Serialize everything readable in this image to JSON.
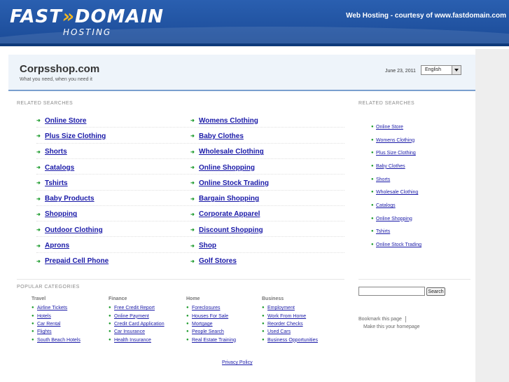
{
  "banner": {
    "logo_main_a": "FAST",
    "logo_main_b": "DOMAIN",
    "logo_sub": "HOSTING",
    "credit": "Web Hosting - courtesy of www.fastdomain.com"
  },
  "header": {
    "title": "Corpsshop.com",
    "tagline": "What you need, when you need it",
    "date": "June 23, 2011",
    "language": "English"
  },
  "related_label": "RELATED SEARCHES",
  "main_links": [
    "Online Store",
    "Womens Clothing",
    "Plus Size Clothing",
    "Baby Clothes",
    "Shorts",
    "Wholesale Clothing",
    "Catalogs",
    "Online Shopping",
    "Tshirts",
    "Online Stock Trading",
    "Baby Products",
    "Bargain Shopping",
    "Shopping",
    "Corporate Apparel",
    "Outdoor Clothing",
    "Discount Shopping",
    "Aprons",
    "Shop",
    "Prepaid Cell Phone",
    "Golf Stores"
  ],
  "side_label": "RELATED SEARCHES",
  "side_links": [
    "Online Store",
    "Womens Clothing",
    "Plus Size Clothing",
    "Baby Clothes",
    "Shorts",
    "Wholesale Clothing",
    "Catalogs",
    "Online Shopping",
    "Tshirts",
    "Online Stock Trading"
  ],
  "popular_label": "POPULAR CATEGORIES",
  "categories": [
    {
      "heading": "Travel",
      "items": [
        "Airline Tickets",
        "Hotels",
        "Car Rental",
        "Flights",
        "South Beach Hotels"
      ]
    },
    {
      "heading": "Finance",
      "items": [
        "Free Credit Report",
        "Online Payment",
        "Credit Card Application",
        "Car Insurance",
        "Health Insurance"
      ]
    },
    {
      "heading": "Home",
      "items": [
        "Foreclosures",
        "Houses For Sale",
        "Mortgage",
        "People Search",
        "Real Estate Training"
      ]
    },
    {
      "heading": "Business",
      "items": [
        "Employment",
        "Work From Home",
        "Reorder Checks",
        "Used Cars",
        "Business Opportunities"
      ]
    }
  ],
  "search": {
    "button": "Search",
    "value": ""
  },
  "bookmark": "Bookmark this page",
  "homepage": "Make this your homepage",
  "privacy": "Privacy Policy",
  "icons": {
    "arrow": "arrow-right-icon",
    "bullet": "bullet-icon",
    "dropdown": "chevron-down-icon"
  },
  "colors": {
    "banner": "#1a4a96",
    "link": "#1a1aa8",
    "bullet": "#1a9a2a",
    "header_bg": "#eef4fa"
  }
}
